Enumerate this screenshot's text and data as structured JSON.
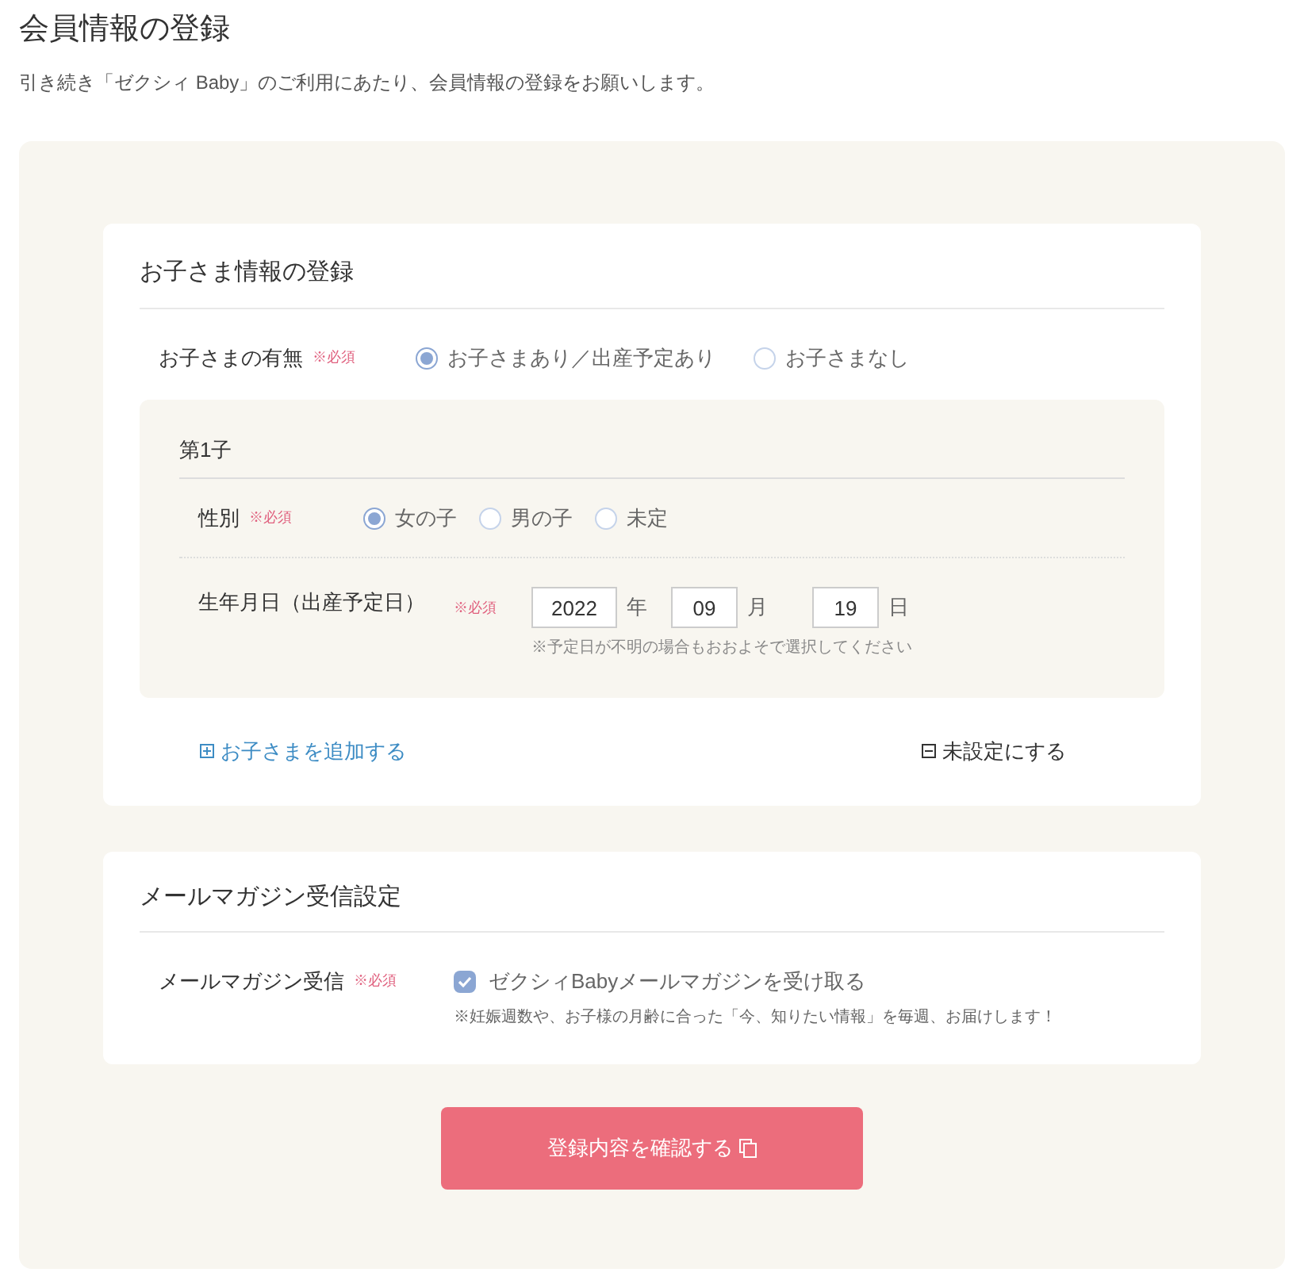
{
  "page": {
    "title": "会員情報の登録",
    "subtitle": "引き続き「ゼクシィ Baby」のご利用にあたり、会員情報の登録をお願いします。"
  },
  "child_section": {
    "title": "お子さま情報の登録",
    "has_child": {
      "label": "お子さまの有無",
      "required": "※必須",
      "options": [
        {
          "label": "お子さまあり／出産予定あり",
          "selected": true
        },
        {
          "label": "お子さまなし",
          "selected": false
        }
      ]
    },
    "children": [
      {
        "title": "第1子",
        "gender": {
          "label": "性別",
          "required": "※必須",
          "options": [
            {
              "label": "女の子",
              "selected": true
            },
            {
              "label": "男の子",
              "selected": false
            },
            {
              "label": "未定",
              "selected": false
            }
          ]
        },
        "birthday": {
          "label": "生年月日（出産予定日）",
          "required": "※必須",
          "year": "2022",
          "year_unit": "年",
          "month": "09",
          "month_unit": "月",
          "day": "19",
          "day_unit": "日",
          "note": "※予定日が不明の場合もおおよそで選択してください"
        }
      }
    ],
    "add_link": "お子さまを追加する",
    "unset_link": "未設定にする"
  },
  "mail_section": {
    "title": "メールマガジン受信設定",
    "label": "メールマガジン受信",
    "required": "※必須",
    "checkbox": {
      "label": "ゼクシィBabyメールマガジンを受け取る",
      "checked": true
    },
    "note": "※妊娠週数や、お子様の月齢に合った「今、知りたい情報」を毎週、お届けします！"
  },
  "submit": "登録内容を確認する"
}
